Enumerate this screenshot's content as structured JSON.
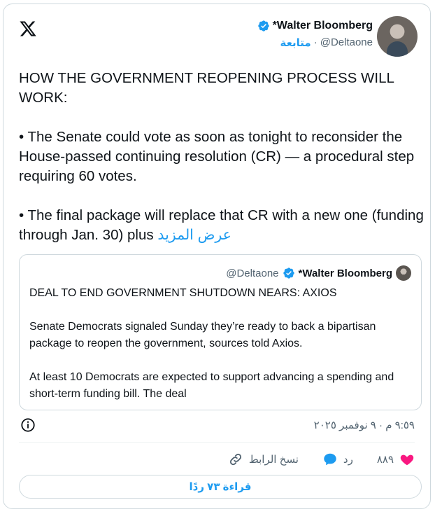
{
  "author": {
    "name": "*Walter Bloomberg",
    "handle": "@Deltaone",
    "separator": "·",
    "follow_label": "متابعة"
  },
  "tweet": {
    "line1": "HOW THE GOVERNMENT REOPENING PROCESS WILL WORK:",
    "line2": "• The Senate could vote as soon as tonight to reconsider the House-passed continuing resolution (CR) — a procedural step requiring 60 votes.",
    "line3": "• The final package will replace that CR with a new one (funding through Jan. 30) plus",
    "show_more": "عرض المزيد"
  },
  "quote": {
    "name": "*Walter Bloomberg",
    "handle": "@Deltaone",
    "p1": "DEAL TO END GOVERNMENT SHUTDOWN NEARS: AXIOS",
    "p2": "Senate Democrats signaled Sunday they’re ready to back a bipartisan package to reopen the government, sources told Axios.",
    "p3": "At least 10 Democrats are expected to support advancing a spending and short-term funding bill. The deal"
  },
  "timestamp": "٩:٥٩ م · ٩ نوفمبر ٢٠٢٥",
  "actions": {
    "likes": "٨٨٩",
    "reply_label": "رد",
    "copy_link_label": "نسخ الرابط"
  },
  "read_replies_label": "قراءة ٧٣ ردًا",
  "colors": {
    "accent": "#1d9bf0",
    "like": "#f91880",
    "text": "#0f1419",
    "muted": "#536471"
  }
}
